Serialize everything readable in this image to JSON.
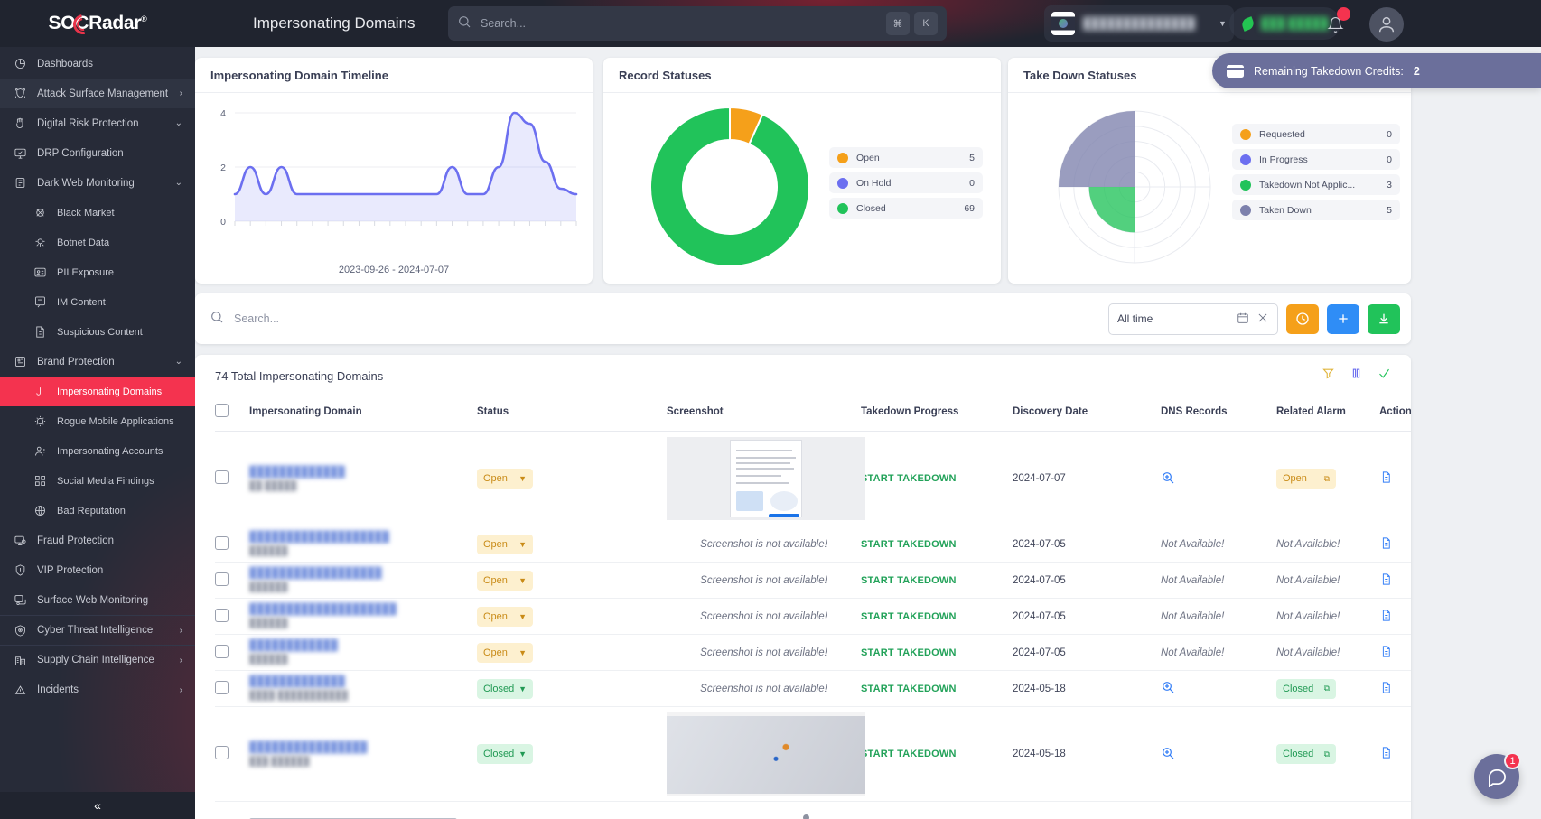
{
  "brand": {
    "name": "SOCRadar",
    "reg": "®"
  },
  "header": {
    "page_title": "Impersonating Domains",
    "search_placeholder": "Search...",
    "kbd_cmd": "⌘",
    "kbd_k": "K",
    "org_name": "██████████████",
    "status_text": "███ █████",
    "notification_count": "",
    "icons": {
      "search": "search-icon",
      "bell": "bell-icon",
      "avatar": "user-avatar-icon"
    }
  },
  "credits": {
    "label": "Remaining Takedown Credits:",
    "value": "2"
  },
  "sidebar": {
    "items": [
      {
        "label": "Dashboards",
        "level": 1,
        "icon": "dashboard-icon",
        "state": "normal",
        "chevron": ""
      },
      {
        "label": "Attack Surface Management",
        "level": 1,
        "icon": "shield-scan-icon",
        "state": "hl",
        "chevron": "›"
      },
      {
        "label": "Digital Risk Protection",
        "level": 1,
        "icon": "hand-shield-icon",
        "state": "normal",
        "chevron": "⌄"
      },
      {
        "label": "DRP Configuration",
        "level": 1,
        "icon": "monitor-config-icon",
        "state": "normal",
        "chevron": ""
      },
      {
        "label": "Dark Web Monitoring",
        "level": 1,
        "icon": "darkweb-icon",
        "state": "normal",
        "chevron": "⌄"
      },
      {
        "label": "Black Market",
        "level": 2,
        "icon": "black-market-icon",
        "state": "normal",
        "chevron": ""
      },
      {
        "label": "Botnet Data",
        "level": 2,
        "icon": "botnet-icon",
        "state": "normal",
        "chevron": ""
      },
      {
        "label": "PII Exposure",
        "level": 2,
        "icon": "id-card-icon",
        "state": "normal",
        "chevron": ""
      },
      {
        "label": "IM Content",
        "level": 2,
        "icon": "im-content-icon",
        "state": "normal",
        "chevron": ""
      },
      {
        "label": "Suspicious Content",
        "level": 2,
        "icon": "suspicious-content-icon",
        "state": "normal",
        "chevron": ""
      },
      {
        "label": "Brand Protection",
        "level": 1,
        "icon": "brand-icon",
        "state": "normal",
        "chevron": "⌄"
      },
      {
        "label": "Impersonating Domains",
        "level": 2,
        "icon": "domain-icon",
        "state": "active",
        "chevron": ""
      },
      {
        "label": "Rogue Mobile Applications",
        "level": 2,
        "icon": "rogue-app-icon",
        "state": "normal",
        "chevron": ""
      },
      {
        "label": "Impersonating Accounts",
        "level": 2,
        "icon": "account-icon",
        "state": "normal",
        "chevron": ""
      },
      {
        "label": "Social Media Findings",
        "level": 2,
        "icon": "social-media-icon",
        "state": "normal",
        "chevron": ""
      },
      {
        "label": "Bad Reputation",
        "level": 2,
        "icon": "globe-icon",
        "state": "normal",
        "chevron": ""
      },
      {
        "label": "Fraud Protection",
        "level": 1,
        "icon": "fraud-icon",
        "state": "normal",
        "chevron": ""
      },
      {
        "label": "VIP Protection",
        "level": 1,
        "icon": "vip-icon",
        "state": "normal",
        "chevron": ""
      },
      {
        "label": "Surface Web Monitoring",
        "level": 1,
        "icon": "surface-web-icon",
        "state": "normal",
        "chevron": ""
      },
      {
        "label": "Cyber Threat Intelligence",
        "level": 1,
        "icon": "eye-shield-icon",
        "state": "sep",
        "chevron": "›"
      },
      {
        "label": "Supply Chain Intelligence",
        "level": 1,
        "icon": "supply-chain-icon",
        "state": "sep",
        "chevron": "›"
      },
      {
        "label": "Incidents",
        "level": 1,
        "icon": "incidents-icon",
        "state": "sep",
        "chevron": "›"
      }
    ],
    "collapse_icon": "«"
  },
  "widgets": {
    "timeline": {
      "title": "Impersonating Domain Timeline",
      "date_range": "2023-09-26 - 2024-07-07"
    },
    "record_statuses": {
      "title": "Record Statuses"
    },
    "takedown_statuses": {
      "title": "Take Down Statuses"
    }
  },
  "chart_data": [
    {
      "type": "area",
      "title": "Impersonating Domain Timeline",
      "xlabel": "",
      "ylabel": "",
      "ylim": [
        0,
        4
      ],
      "yticks": [
        0,
        2,
        4
      ],
      "grid": true,
      "legend": "none",
      "annotations": [
        "2023-09-26 - 2024-07-07"
      ],
      "x": [
        0,
        1,
        2,
        3,
        4,
        5,
        6,
        7,
        8,
        9,
        10,
        11,
        12,
        13,
        14,
        15,
        16,
        17,
        18,
        19,
        20,
        21,
        22
      ],
      "values": [
        1,
        2,
        1,
        2,
        1,
        1,
        1,
        1,
        1,
        1,
        1,
        1,
        1,
        1,
        2,
        1,
        1,
        2,
        4,
        3.6,
        2.2,
        1.2,
        1
      ]
    },
    {
      "type": "pie",
      "title": "Record Statuses",
      "donut": true,
      "legend_position": "right",
      "categories": [
        "Open",
        "On Hold",
        "Closed"
      ],
      "values": [
        5,
        0,
        69
      ],
      "colors": [
        "#f5a01a",
        "#6c6ff0",
        "#21c35a"
      ]
    },
    {
      "type": "pie",
      "title": "Take Down Statuses",
      "polar": true,
      "legend_position": "right",
      "categories": [
        "Requested",
        "In Progress",
        "Takedown Not Applic...",
        "Taken Down"
      ],
      "values": [
        0,
        0,
        3,
        5
      ],
      "colors": [
        "#f5a01a",
        "#6c6ff0",
        "#21c35a",
        "#7d81ad"
      ]
    }
  ],
  "filters": {
    "search_placeholder": "Search...",
    "date_label": "All time",
    "calendar_icon": "calendar-icon",
    "clear_icon": "close-icon",
    "buttons": [
      {
        "name": "history-button",
        "icon": "clock-icon",
        "color": "#f5a01a"
      },
      {
        "name": "add-button",
        "icon": "plus-icon",
        "color": "#2f8df6"
      },
      {
        "name": "download-button",
        "icon": "download-icon",
        "color": "#21c35a"
      }
    ]
  },
  "table": {
    "total_label": "74 Total Impersonating Domains",
    "tools": [
      {
        "name": "filter-funnel-icon",
        "color": "#e0b53c"
      },
      {
        "name": "pause-icon",
        "color": "#6c6ff0"
      },
      {
        "name": "check-icon",
        "color": "#21c35a"
      }
    ],
    "columns": [
      "Impersonating Domain",
      "Status",
      "Screenshot",
      "Takedown Progress",
      "Discovery Date",
      "DNS Records",
      "Related Alarm",
      "Actions"
    ],
    "rows": [
      {
        "domain": "█████████████",
        "domain_sub": "██ █████",
        "status": "Open",
        "status_kind": "open",
        "screenshot": "thumbnail",
        "screenshot_text": "",
        "takedown": "START TAKEDOWN",
        "date": "2024-07-07",
        "dns": "icon",
        "alarm": "Open",
        "alarm_kind": "open",
        "tall": true
      },
      {
        "domain": "███████████████████",
        "domain_sub": "██████",
        "status": "Open",
        "status_kind": "open",
        "screenshot": "text",
        "screenshot_text": "Screenshot is not available!",
        "takedown": "START TAKEDOWN",
        "date": "2024-07-05",
        "dns": "Not Available!",
        "alarm": "Not Available!",
        "alarm_kind": "na",
        "tall": false
      },
      {
        "domain": "██████████████████",
        "domain_sub": "██████",
        "status": "Open",
        "status_kind": "open",
        "screenshot": "text",
        "screenshot_text": "Screenshot is not available!",
        "takedown": "START TAKEDOWN",
        "date": "2024-07-05",
        "dns": "Not Available!",
        "alarm": "Not Available!",
        "alarm_kind": "na",
        "tall": false
      },
      {
        "domain": "████████████████████",
        "domain_sub": "██████",
        "status": "Open",
        "status_kind": "open",
        "screenshot": "text",
        "screenshot_text": "Screenshot is not available!",
        "takedown": "START TAKEDOWN",
        "date": "2024-07-05",
        "dns": "Not Available!",
        "alarm": "Not Available!",
        "alarm_kind": "na",
        "tall": false
      },
      {
        "domain": "████████████",
        "domain_sub": "██████",
        "status": "Open",
        "status_kind": "open",
        "screenshot": "text",
        "screenshot_text": "Screenshot is not available!",
        "takedown": "START TAKEDOWN",
        "date": "2024-07-05",
        "dns": "Not Available!",
        "alarm": "Not Available!",
        "alarm_kind": "na",
        "tall": false
      },
      {
        "domain": "█████████████",
        "domain_sub": "████ ███████████",
        "status": "Closed",
        "status_kind": "closed",
        "screenshot": "text",
        "screenshot_text": "Screenshot is not available!",
        "takedown": "START TAKEDOWN",
        "date": "2024-05-18",
        "dns": "icon",
        "alarm": "Closed",
        "alarm_kind": "closed",
        "tall": false
      },
      {
        "domain": "████████████████",
        "domain_sub": "███ ██████",
        "status": "Closed",
        "status_kind": "closed",
        "screenshot": "thumbnail2",
        "screenshot_text": "",
        "takedown": "START TAKEDOWN",
        "date": "2024-05-18",
        "dns": "icon",
        "alarm": "Closed",
        "alarm_kind": "closed",
        "tall": true
      }
    ]
  },
  "chat": {
    "badge": "1",
    "icon": "chat-icon"
  }
}
